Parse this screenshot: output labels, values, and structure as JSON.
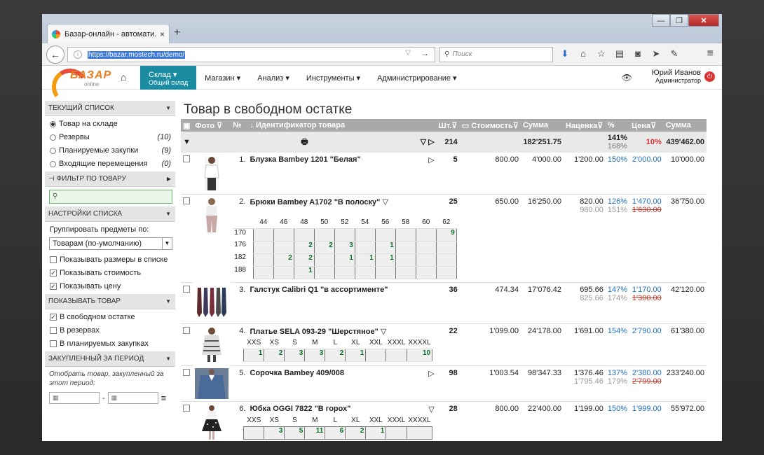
{
  "browser": {
    "tab_title": "Базар-онлайн - автомати...",
    "tab_close": "×",
    "new_tab": "+",
    "url": "https://bazar.mostech.ru/demo/",
    "search_placeholder": "Поиск",
    "win_buttons": [
      "—",
      "❐",
      "✕"
    ]
  },
  "app": {
    "logo_text": "БАЗАР",
    "logo_sub": "online",
    "menu": [
      {
        "label": "Склад ▾",
        "sub": "Общий склад"
      },
      {
        "label": "Магазин ▾"
      },
      {
        "label": "Анализ ▾"
      },
      {
        "label": "Инструменты ▾"
      },
      {
        "label": "Администрирование ▾"
      }
    ],
    "user_name": "Юрий Иванов",
    "user_role": "Администратор"
  },
  "sidebar": {
    "current_list": "ТЕКУЩИЙ СПИСОК",
    "lists": [
      {
        "label": "Товар на складе",
        "count": "",
        "checked": true
      },
      {
        "label": "Резервы",
        "count": "(10)"
      },
      {
        "label": "Планируемые закупки",
        "count": "(9)"
      },
      {
        "label": "Входящие перемещения",
        "count": "(0)"
      }
    ],
    "filter_head": "ФИЛЬТР ПО ТОВАРУ",
    "list_settings": "НАСТРОЙКИ СПИСКА",
    "group_by_label": "Группировать предметы по:",
    "group_by_value": "Товарам (по-умолчанию)",
    "settings_checks": [
      {
        "label": "Показывать размеры в списке",
        "checked": false
      },
      {
        "label": "Показывать стоимость",
        "checked": true
      },
      {
        "label": "Показывать цену",
        "checked": true
      }
    ],
    "show_head": "ПОКАЗЫВАТЬ ТОВАР",
    "show_checks": [
      {
        "label": "В свободном остатке",
        "checked": true
      },
      {
        "label": "В резервах",
        "checked": false
      },
      {
        "label": "В планируемых закупках",
        "checked": false
      }
    ],
    "period_head": "ЗАКУПЛЕННЫЙ ЗА ПЕРИОД",
    "period_note": "Отобрать товар, закупленный за этот период:",
    "date_sep": "-"
  },
  "main": {
    "title": "Товар в свободном остатке",
    "columns": [
      "Фото",
      "№",
      "Идентификатор товара",
      "Шт.",
      "Стоимость",
      "Сумма",
      "Наценка",
      "%",
      "Цена",
      "Сумма"
    ],
    "totals": {
      "qty": "214",
      "sum": "182'251.75",
      "pct_main": "141%",
      "pct_sub": "168%",
      "price_pct": "10%",
      "total": "439'462.00"
    },
    "rows": [
      {
        "num": "1.",
        "name": "Блузка Bambey 1201 \"Белая\"",
        "qty": "5",
        "cost": "800.00",
        "sum": "4'000.00",
        "markup": "1'200.00",
        "pct": "150%",
        "price": "2'000.00",
        "total": "10'000.00"
      },
      {
        "num": "2.",
        "name": "Брюки Bambey A1702 \"В полоску\"",
        "qty": "25",
        "cost": "650.00",
        "sum": "16'250.00",
        "markup": "820.00",
        "markup2": "980.00",
        "pct": "126%",
        "pct2": "151%",
        "price": "1'470.00",
        "price2": "1'630.00",
        "total": "36'750.00"
      },
      {
        "num": "3.",
        "name": "Галстук Calibri Q1 \"в ассортименте\"",
        "qty": "36",
        "cost": "474.34",
        "sum": "17'076.42",
        "markup": "695.66",
        "markup2": "825.66",
        "pct": "147%",
        "pct2": "174%",
        "price": "1'170.00",
        "price2": "1'300.00",
        "total": "42'120.00"
      },
      {
        "num": "4.",
        "name": "Платье SELA 093-29 \"Шерстяное\"",
        "qty": "22",
        "cost": "1'099.00",
        "sum": "24'178.00",
        "markup": "1'691.00",
        "pct": "154%",
        "price": "2'790.00",
        "total": "61'380.00"
      },
      {
        "num": "5.",
        "name": "Сорочка Bambey 409/008",
        "qty": "98",
        "cost": "1'003.54",
        "sum": "98'347.33",
        "markup": "1'376.46",
        "markup2": "1'795.46",
        "pct": "137%",
        "pct2": "179%",
        "price": "2'380.00",
        "price2": "2'799.00",
        "total": "233'240.00"
      },
      {
        "num": "6.",
        "name": "Юбка OGGI 7822 \"В горох\"",
        "qty": "28",
        "cost": "800.00",
        "sum": "22'400.00",
        "markup": "1'199.00",
        "pct": "150%",
        "price": "1'999.00",
        "total": "55'972.00"
      }
    ],
    "pants_sizes": {
      "cols": [
        "44",
        "46",
        "48",
        "50",
        "52",
        "54",
        "56",
        "58",
        "60",
        "62"
      ],
      "rows": [
        {
          "label": "170",
          "vals": [
            "",
            "",
            "",
            "",
            "",
            "",
            "",
            "",
            "",
            "9"
          ]
        },
        {
          "label": "176",
          "vals": [
            "",
            "",
            "2",
            "2",
            "3",
            "",
            "1",
            "",
            "",
            ""
          ]
        },
        {
          "label": "182",
          "vals": [
            "",
            "2",
            "2",
            "",
            "1",
            "1",
            "1",
            "",
            "",
            ""
          ]
        },
        {
          "label": "188",
          "vals": [
            "",
            "",
            "1",
            "",
            "",
            "",
            "",
            "",
            "",
            ""
          ]
        }
      ]
    },
    "dress_sizes": {
      "cols": [
        "XXS",
        "XS",
        "S",
        "M",
        "L",
        "XL",
        "XXL",
        "XXXL",
        "XXXXL"
      ],
      "vals": [
        "1",
        "2",
        "3",
        "3",
        "2",
        "1",
        "",
        "",
        "10"
      ]
    },
    "skirt_sizes": {
      "cols": [
        "XXS",
        "XS",
        "S",
        "M",
        "L",
        "XL",
        "XXL",
        "XXXL",
        "XXXXL"
      ],
      "vals": [
        "",
        "3",
        "5",
        "11",
        "6",
        "2",
        "1",
        "",
        ""
      ]
    }
  }
}
